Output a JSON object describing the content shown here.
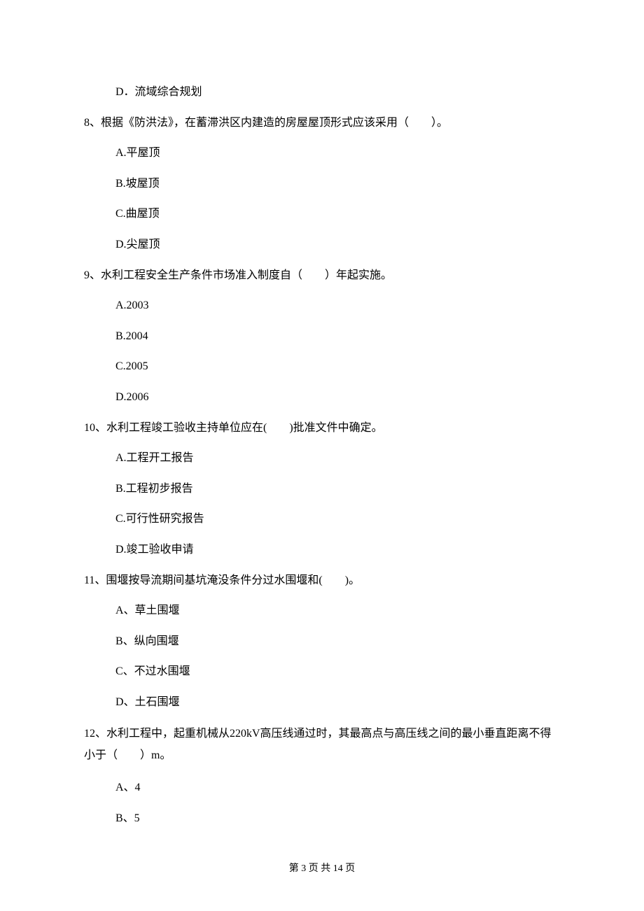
{
  "q7": {
    "optD": "D．流域综合规划"
  },
  "q8": {
    "text": "8、根据《防洪法》，在蓄滞洪区内建造的房屋屋顶形式应该采用（　　）。",
    "optA": "A.平屋顶",
    "optB": "B.坡屋顶",
    "optC": "C.曲屋顶",
    "optD": "D.尖屋顶"
  },
  "q9": {
    "text": "9、水利工程安全生产条件市场准入制度自（　　）年起实施。",
    "optA": "A.2003",
    "optB": "B.2004",
    "optC": "C.2005",
    "optD": "D.2006"
  },
  "q10": {
    "text": "10、水利工程竣工验收主持单位应在(　　)批准文件中确定。",
    "optA": "A.工程开工报告",
    "optB": "B.工程初步报告",
    "optC": "C.可行性研究报告",
    "optD": "D.竣工验收申请"
  },
  "q11": {
    "text": "11、围堰按导流期间基坑淹没条件分过水围堰和(　　)。",
    "optA": "A、草土围堰",
    "optB": "B、纵向围堰",
    "optC": "C、不过水围堰",
    "optD": "D、土石围堰"
  },
  "q12": {
    "text": "12、水利工程中，起重机械从220kV高压线通过时，其最高点与高压线之间的最小垂直距离不得小于（　　）m。",
    "optA": "A、4",
    "optB": "B、5"
  },
  "footer": "第 3 页 共 14 页"
}
